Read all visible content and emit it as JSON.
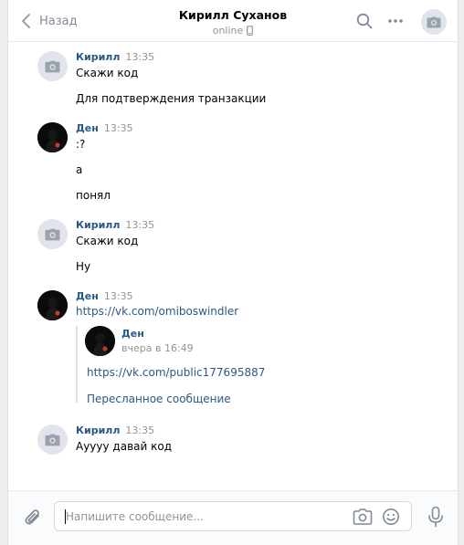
{
  "header": {
    "back_label": "Назад",
    "title": "Кирилл Суханов",
    "status": "online"
  },
  "messages": [
    {
      "author": "Кирилл",
      "time": "13:35",
      "lines": [
        "Скажи код",
        "Для подтверждения транзакции"
      ]
    },
    {
      "author": "Ден",
      "time": "13:35",
      "lines": [
        ":?",
        "а",
        "понял"
      ]
    },
    {
      "author": "Кирилл",
      "time": "13:35",
      "lines": [
        "Скажи код",
        "Ну"
      ]
    },
    {
      "author": "Ден",
      "time": "13:35",
      "link": "https://vk.com/omiboswindler",
      "forwarded": {
        "author": "Ден",
        "time": "вчера в 16:49",
        "link": "https://vk.com/public177695887",
        "label": "Пересланное сообщение"
      }
    },
    {
      "author": "Кирилл",
      "time": "13:35",
      "lines": [
        "Ауууу давай код"
      ]
    }
  ],
  "composer": {
    "placeholder": "Напишите сообщение..."
  },
  "icons": {
    "back": "chevron-left-icon",
    "search": "search-icon",
    "more": "more-icon",
    "avatar": "camera-icon",
    "attach": "paperclip-icon",
    "camera": "camera-icon",
    "smile": "smile-icon",
    "mic": "microphone-icon",
    "mobile": "mobile-icon"
  },
  "colors": {
    "link": "#2a5885",
    "muted": "#939393",
    "icon": "#828a99",
    "background": "#edeef0"
  }
}
